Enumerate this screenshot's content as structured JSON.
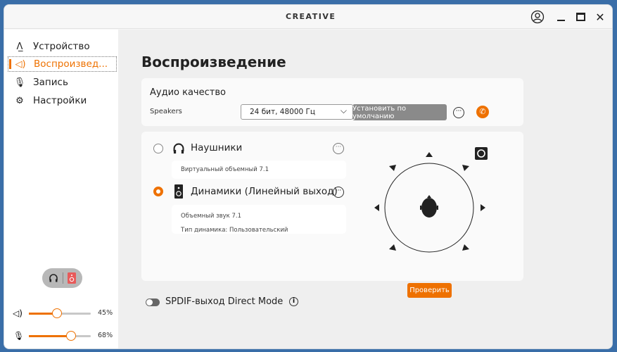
{
  "app": {
    "logo": "CREATIVE"
  },
  "sidebar": {
    "items": [
      {
        "label": "Устройство",
        "icon": "device-icon"
      },
      {
        "label": "Воспроизвед...",
        "icon": "speaker-icon",
        "active": true
      },
      {
        "label": "Запись",
        "icon": "microphone-icon"
      },
      {
        "label": "Настройки",
        "icon": "gear-icon"
      }
    ],
    "volume": {
      "label": "45%",
      "value": 45
    },
    "mic": {
      "label": "68%",
      "value": 68
    }
  },
  "main": {
    "title": "Воспроизведение",
    "quality": {
      "heading": "Аудио качество",
      "device": "Speakers",
      "format": "24 бит, 48000 Гц",
      "set_default": "Установить по умолчанию"
    },
    "outputs": [
      {
        "name": "Наушники",
        "details": [
          "Виртуальный объемный 7.1"
        ],
        "selected": false
      },
      {
        "name": "Динамики (Линейный выход)",
        "details": [
          "Объемный звук 7.1",
          "Тип динамика: Пользовательский"
        ],
        "selected": true
      }
    ],
    "test_button": "Проверить",
    "spdif": {
      "label": "SPDIF-выход Direct Mode",
      "enabled": false
    }
  },
  "colors": {
    "accent": "#ee7100"
  }
}
